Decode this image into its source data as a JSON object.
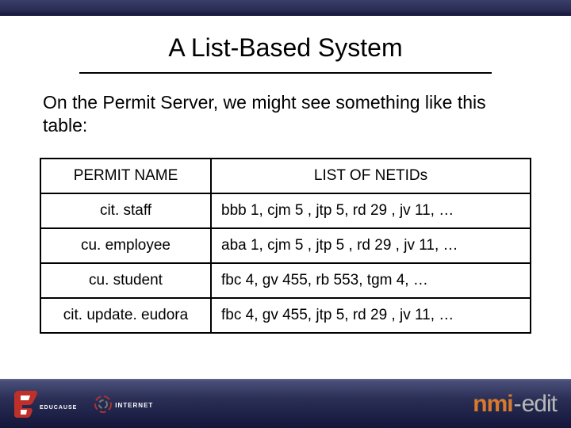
{
  "title": "A List-Based System",
  "intro": "On the Permit Server, we might see something like this table:",
  "table": {
    "headers": {
      "col0": "PERMIT NAME",
      "col1": "LIST OF NETIDs"
    },
    "rows": [
      {
        "name": "cit. staff",
        "list": "bbb 1, cjm 5 , jtp 5, rd 29 , jv 11, …"
      },
      {
        "name": "cu. employee",
        "list": "aba 1, cjm 5 , jtp 5 , rd 29 , jv 11, …"
      },
      {
        "name": "cu. student",
        "list": "fbc 4, gv 455, rb 553, tgm 4, …"
      },
      {
        "name": "cit. update. eudora",
        "list": "fbc 4, gv 455, jtp 5, rd 29 , jv 11, …"
      }
    ]
  },
  "footer": {
    "educause": "EDUCAUSE",
    "internet2": "INTERNET",
    "nmi": {
      "a": "nmi",
      "b": "-",
      "c": "edit"
    }
  }
}
